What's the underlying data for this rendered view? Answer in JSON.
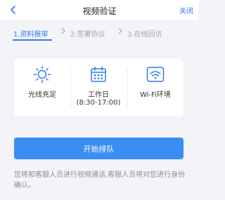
{
  "navbar": {
    "title": "视频验证",
    "close_label": "关闭",
    "back_icon": "chevron-left-icon"
  },
  "steps": [
    {
      "label": "1.资料报审",
      "active": true
    },
    {
      "label": "2.签署协议",
      "active": false
    },
    {
      "label": "3.在线回访",
      "active": false
    }
  ],
  "requirements": [
    {
      "icon": "sun-icon",
      "label": "光线充足",
      "sub": ""
    },
    {
      "icon": "calendar-icon",
      "label": "工作日",
      "sub": "(8:30-17:00)"
    },
    {
      "icon": "wifi-icon",
      "label": "Wi-Fi环境",
      "sub": ""
    }
  ],
  "queue_button": {
    "label": "开始排队"
  },
  "note": "您将和客服人员进行视频通话,客服人员将对您进行身份确认。",
  "colors": {
    "accent": "#2f7bf1",
    "button": "#3b8cf5",
    "background": "#f3f4f8",
    "muted": "#a0a5ad"
  }
}
